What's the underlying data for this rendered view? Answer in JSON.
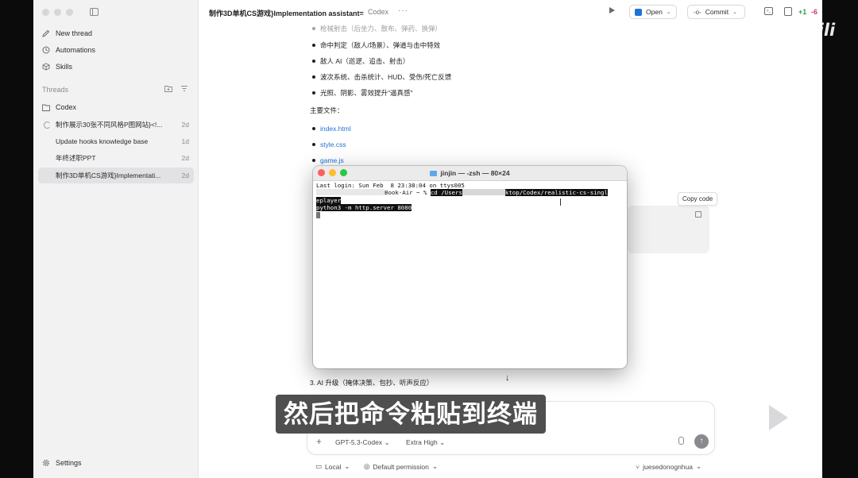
{
  "sidebar": {
    "nav": [
      {
        "label": "New thread",
        "icon": "edit-icon"
      },
      {
        "label": "Automations",
        "icon": "clock-icon"
      },
      {
        "label": "Skills",
        "icon": "cube-icon"
      }
    ],
    "section_label": "Threads",
    "folder": "Codex",
    "threads": [
      {
        "title": "制作展示30张不同风格P图网站}<!...",
        "date": "2d"
      },
      {
        "title": "Update hooks knowledge base",
        "date": "1d"
      },
      {
        "title": "年终述职PPT",
        "date": "2d"
      },
      {
        "title": "制作3D单机CS游戏}Implementati...",
        "date": "2d"
      }
    ],
    "settings": "Settings"
  },
  "header": {
    "title": "制作3D单机CS游戏}Implementation assistant=",
    "project": "Codex",
    "open_label": "Open",
    "commit_label": "Commit",
    "diff_add": "+1",
    "diff_del": "-6"
  },
  "content": {
    "bullets_top": [
      "枪械射击（后坐力、散布、弹药、换弹）",
      "命中判定（敌人/场景）、弹道与击中特效",
      "敌人 AI（巡逻、追击、射击）",
      "波次系统、击杀统计、HUD、受伤/死亡反馈",
      "光照、阴影、雾效提升\"逼真感\""
    ],
    "files_heading": "主要文件：",
    "files": [
      "index.html",
      "style.css",
      "game.js"
    ],
    "list_tail": "3. AI 升级（掩体决策、包抄、听声反应）",
    "copy_code": "Copy code"
  },
  "terminal": {
    "title": "jinjin — -zsh — 80×24",
    "lines": {
      "login": "Last login: Sun Feb  8 23:38:04 on ttys005",
      "prompt_host": "Book-Air ~ % ",
      "cmd_a": "cd /Users",
      "cmd_b": "ktop/Codex/realistic-cs-singl",
      "cmd_c": "eplayer",
      "cmd_d": "python3 -m http.server 8080"
    }
  },
  "composer": {
    "model": "GPT-5.3-Codex",
    "effort": "Extra High",
    "local": "Local",
    "permission": "Default permission",
    "branch": "juesedonognhua"
  },
  "overlay": {
    "subtitle": "然后把命令粘贴到终端",
    "watermark": "bilibili"
  }
}
